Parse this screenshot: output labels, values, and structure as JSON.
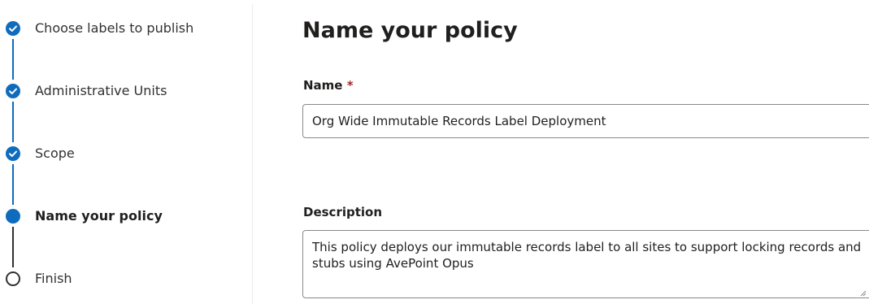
{
  "stepper": {
    "steps": [
      {
        "label": "Choose labels to publish",
        "state": "completed"
      },
      {
        "label": "Administrative Units",
        "state": "completed"
      },
      {
        "label": "Scope",
        "state": "completed"
      },
      {
        "label": "Name your policy",
        "state": "current"
      },
      {
        "label": "Finish",
        "state": "upcoming"
      }
    ]
  },
  "main": {
    "title": "Name your policy",
    "name_label": "Name",
    "required_marker": "*",
    "name_value": "Org Wide Immutable Records Label Deployment",
    "description_label": "Description",
    "description_value": "This policy deploys our immutable records label to all sites to support locking records and stubs using AvePoint Opus"
  },
  "colors": {
    "accent": "#0f6cbd",
    "text": "#201f1e",
    "required": "#a4262c",
    "border": "#8a8886"
  },
  "icons": {
    "completed": "checkmark-circle-icon",
    "current": "filled-circle-icon",
    "upcoming": "empty-circle-icon"
  }
}
